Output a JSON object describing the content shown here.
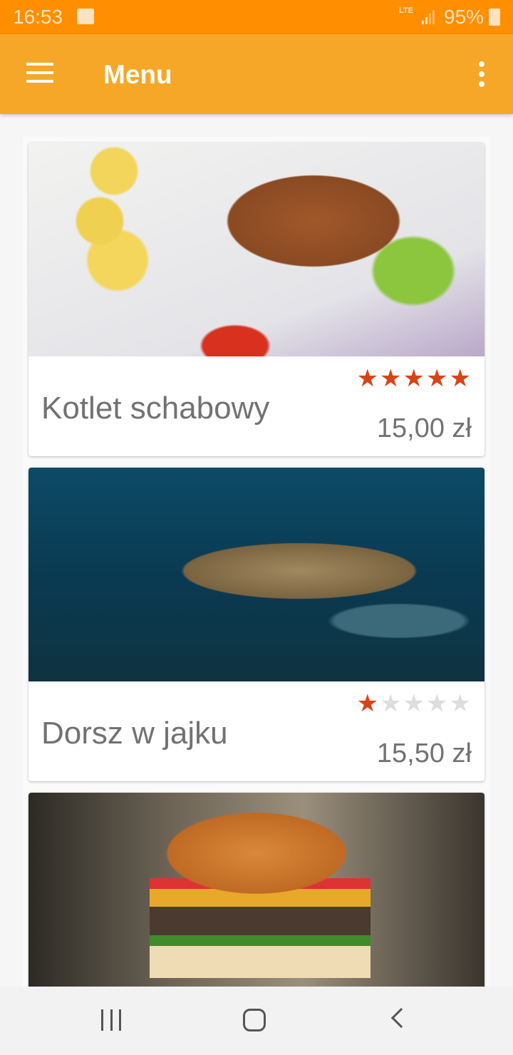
{
  "status_bar": {
    "time": "16:53",
    "network": "LTE",
    "battery": "95%"
  },
  "app_bar": {
    "title": "Menu"
  },
  "items": [
    {
      "name": "Kotlet schabowy",
      "price": "15,00 zł",
      "rating": 5,
      "max_rating": 5
    },
    {
      "name": "Dorsz w jajku",
      "price": "15,50 zł",
      "rating": 1,
      "max_rating": 5
    },
    {
      "name": "",
      "price": "",
      "rating": null,
      "max_rating": 5
    }
  ],
  "colors": {
    "status_bar": "#FF8F00",
    "app_bar": "#F7A727",
    "star_on": "#D84315",
    "star_off": "#DDDDDD"
  }
}
